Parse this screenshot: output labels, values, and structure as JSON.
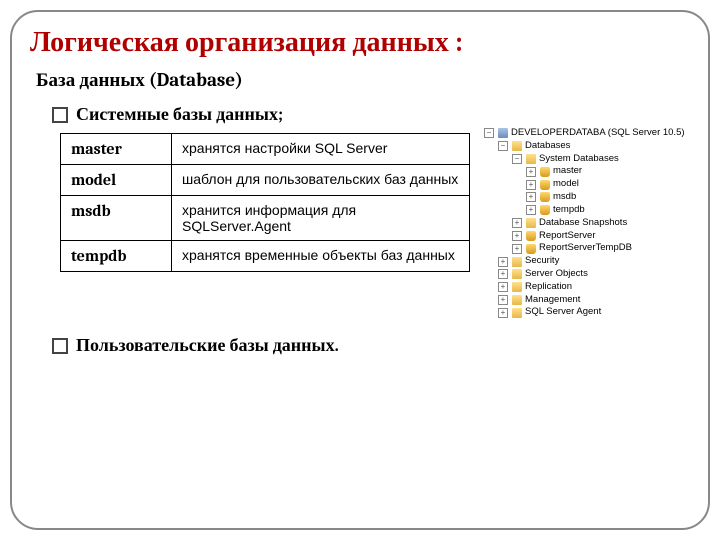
{
  "title": "Логическая организация данных :",
  "subtitle": "База данных (Database)",
  "bullets": {
    "system": "Системные базы данных;",
    "user": "Пользовательские базы данных."
  },
  "table": [
    {
      "name": "master",
      "desc": "хранятся настройки SQL Server"
    },
    {
      "name": "model",
      "desc": "шаблон для пользовательских баз данных"
    },
    {
      "name": "msdb",
      "desc": "хранится информация для SQLServer.Agent"
    },
    {
      "name": "tempdb",
      "desc": "хранятся временные объекты баз данных"
    }
  ],
  "tree": {
    "server": "DEVELOPERDATABA (SQL Server 10.5)",
    "databases": "Databases",
    "sysdb": "System Databases",
    "items": [
      "master",
      "model",
      "msdb",
      "tempdb"
    ],
    "snapshots": "Database Snapshots",
    "report1": "ReportServer",
    "report2": "ReportServerTempDB",
    "security": "Security",
    "serverobj": "Server Objects",
    "replication": "Replication",
    "management": "Management",
    "agent": "SQL Server Agent"
  }
}
